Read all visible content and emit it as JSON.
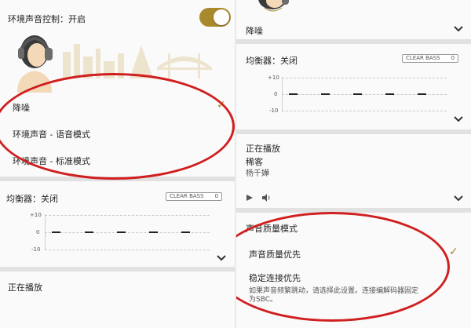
{
  "left": {
    "ambient": {
      "label": "环境声音控制：开启",
      "toggle_on": true
    },
    "modes": [
      {
        "label": "降噪",
        "selected": true
      },
      {
        "label": "环境声音 - 语音模式",
        "selected": false
      },
      {
        "label": "环境声音 - 标准模式",
        "selected": false
      }
    ],
    "eq": {
      "label": "均衡器：关闭",
      "clear_bass_label": "CLEAR BASS",
      "clear_bass_value": "0",
      "ticks": [
        "+10",
        "0",
        "-10"
      ]
    },
    "now_playing": {
      "label": "正在播放"
    }
  },
  "right": {
    "mode_summary": "降噪",
    "eq": {
      "label": "均衡器：关闭",
      "clear_bass_label": "CLEAR BASS",
      "clear_bass_value": "0",
      "ticks": [
        "+10",
        "0",
        "-10"
      ]
    },
    "now_playing": {
      "label": "正在播放",
      "track": "稀客",
      "artist": "杨千嬅"
    },
    "quality": {
      "label": "声音质量模式",
      "options": [
        {
          "label": "声音质量优先",
          "selected": true
        },
        {
          "label": "稳定连接优先",
          "selected": false,
          "desc_line1": "如果声音频繁跳动，请选择此设置。连接编解码器固定",
          "desc_line2": "为SBC。"
        }
      ]
    }
  },
  "colors": {
    "accent": "#a88a2c",
    "annotation": "#d01f1f"
  }
}
